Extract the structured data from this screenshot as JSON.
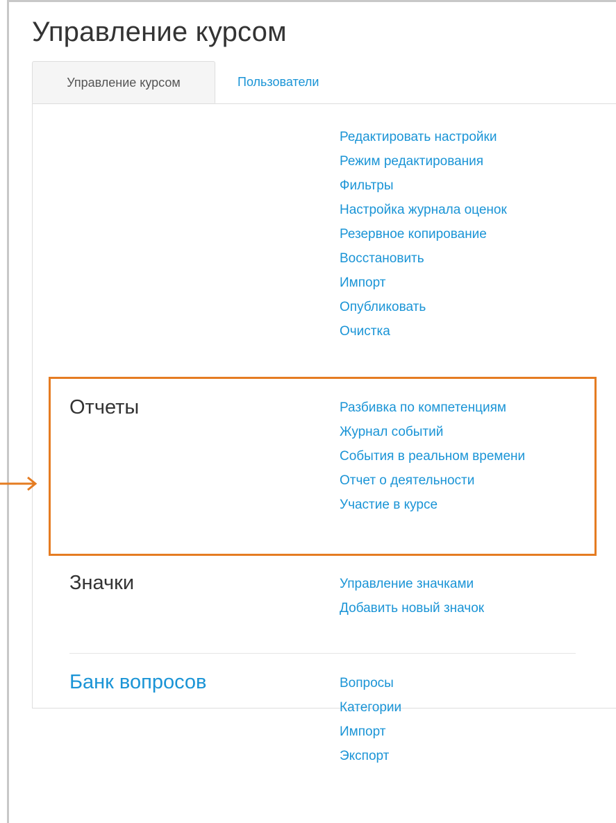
{
  "page": {
    "title": "Управление курсом"
  },
  "tabs": [
    {
      "label": "Управление курсом",
      "active": true
    },
    {
      "label": "Пользователи",
      "active": false
    }
  ],
  "sections": {
    "settings": {
      "title": "",
      "links": [
        "Редактировать настройки",
        "Режим редактирования",
        "Фильтры",
        "Настройка журнала оценок",
        "Резервное копирование",
        "Восстановить",
        "Импорт",
        "Опубликовать",
        "Очистка"
      ]
    },
    "reports": {
      "title": "Отчеты",
      "links": [
        "Разбивка по компетенциям",
        "Журнал событий",
        "События в реальном времени",
        "Отчет о деятельности",
        "Участие в курсе"
      ]
    },
    "badges": {
      "title": "Значки",
      "links": [
        "Управление значками",
        "Добавить новый значок"
      ]
    },
    "question_bank": {
      "title": "Банк вопросов",
      "links": [
        "Вопросы",
        "Категории",
        "Импорт",
        "Экспорт"
      ]
    }
  },
  "colors": {
    "link": "#1a94d6",
    "text": "#333333",
    "highlight": "#e57c22",
    "tab_bg": "#f5f5f5"
  },
  "annotations": {
    "highlight_box": "reports-section",
    "arrow_icon": "arrow-right-icon"
  }
}
